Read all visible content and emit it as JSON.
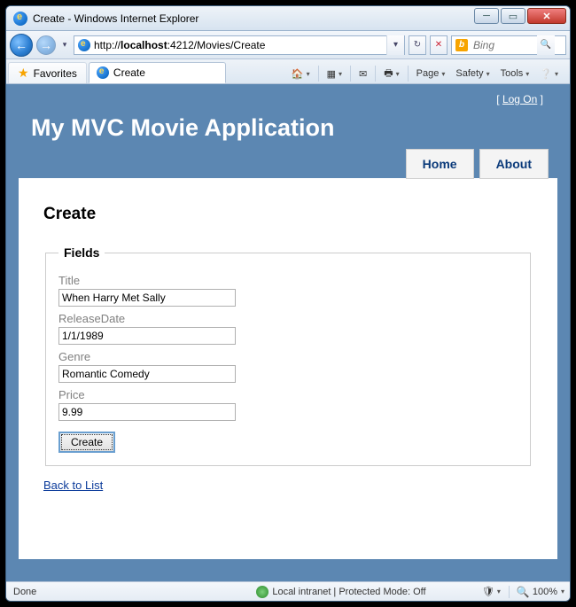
{
  "window": {
    "title": "Create - Windows Internet Explorer"
  },
  "addressbar": {
    "protocol": "http://",
    "host": "localhost",
    "port_path": ":4212/Movies/Create"
  },
  "search": {
    "placeholder": "Bing"
  },
  "favorites_label": "Favorites",
  "tab": {
    "label": "Create"
  },
  "toolbar": {
    "page": "Page",
    "safety": "Safety",
    "tools": "Tools"
  },
  "page": {
    "logon": "Log On",
    "app_title": "My MVC Movie Application",
    "nav": {
      "home": "Home",
      "about": "About"
    },
    "heading": "Create",
    "fieldset_legend": "Fields",
    "labels": {
      "title": "Title",
      "release": "ReleaseDate",
      "genre": "Genre",
      "price": "Price"
    },
    "values": {
      "title": "When Harry Met Sally",
      "release": "1/1/1989",
      "genre": "Romantic Comedy",
      "price": "9.99"
    },
    "create_btn": "Create",
    "back_link": "Back to List"
  },
  "status": {
    "left": "Done",
    "mid": "Local intranet | Protected Mode: Off",
    "zoom": "100%"
  }
}
